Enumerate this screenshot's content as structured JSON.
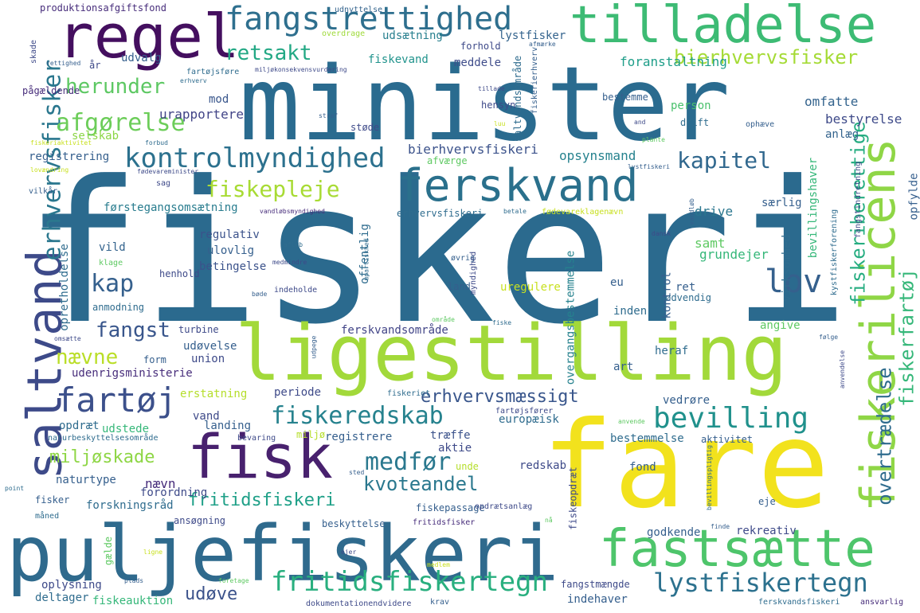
{
  "cloud": {
    "fiskeri": "fiskeri",
    "fare": "fare",
    "minister": "minister",
    "puljefiskeri": "puljefiskeri",
    "ligestilling": "ligestilling",
    "regel": "regel",
    "tilladelse": "tilladelse",
    "fangstrettighed": "fangstrettighed",
    "fisk": "fisk",
    "ferskvand": "ferskvand",
    "fastsaette": "fastsætte",
    "saltvand": "saltvand",
    "fiskerilicens": "fiskerilicens",
    "erhvervsfisker": "erhvervsfisker",
    "fartoej": "fartøj",
    "bevilling": "bevilling",
    "kontrolmyndighed": "kontrolmyndighed",
    "fritidsfiskertegn": "fritidsfiskertegn",
    "lystfiskertegn": "lystfiskertegn",
    "medfoer": "medfør",
    "fiskeredskab": "fiskeredskab",
    "afgoerelse": "afgørelse",
    "herunder": "herunder",
    "retsakt": "retsakt",
    "bierhvervsfisker": "bierhvervsfisker",
    "kapitel": "kapitel",
    "kap": "kap",
    "fiskepleje": "fiskepleje",
    "lov": "lov",
    "fangst": "fangst",
    "naevne": "nævne",
    "erhvervsmaessigt": "erhvervsmæssigt",
    "kvoteandel": "kvoteandel",
    "fritidsfiskeri": "fritidsfiskeri",
    "miljoeskade": "miljøskade",
    "udoeve": "udøve",
    "fiskeriberettige": "fiskeriberettige",
    "overtraedelse": "overtrædelse",
    "fiskerfartoej": "fiskerfartøj",
    "produktionsafgiftsfond": "produktionsafgiftsfond",
    "udnyttelse": "udnyttelse",
    "udsaetning": "udsætning",
    "lystfisker": "lystfisker",
    "overdrage": "overdrage",
    "fiskevand": "fiskevand",
    "udvalg": "udvalg",
    "meddele": "meddele",
    "foranstaltning": "foranstaltning",
    "omfatte": "omfatte",
    "mod": "mod",
    "person": "person",
    "bestyrelse": "bestyrelse",
    "anlaeg": "anlæg",
    "urapportere": "urapportere",
    "selskab": "selskab",
    "bierhvervsfiskeri": "bierhvervsfiskeri",
    "opsynsmand": "opsynsmand",
    "registrering": "registrering",
    "foerstegangsomsaetning": "førstegangsomsætning",
    "drive": "drive",
    "saerlig": "særlig",
    "regulativ": "regulativ",
    "ulovlig": "ulovlig",
    "betingelse": "betingelse",
    "offentlig": "offentlig",
    "samt": "samt",
    "grundejer": "grundejer",
    "vild": "vild",
    "henhold": "henhold",
    "land": "land",
    "uregulere": "uregulere",
    "ret": "ret",
    "noedvendig": "nødvendig",
    "kontrol": "kontrol",
    "inden": "inden",
    "eu": "eu",
    "ferskvandsomraade": "ferskvandsområde",
    "angive": "angive",
    "udoevelse": "udøvelse",
    "union": "union",
    "udenrigsministerie": "udenrigsministerie",
    "heraf": "heraf",
    "art": "art",
    "erstatning": "erstatning",
    "periode": "periode",
    "vedroere": "vedrøre",
    "opdraet": "opdræt",
    "udstede": "udstede",
    "vand": "vand",
    "landing": "landing",
    "europaeisk": "europæisk",
    "registrere": "registrere",
    "traeffe": "træffe",
    "aktie": "aktie",
    "bestemmelse": "bestemmelse",
    "aktivitet": "aktivitet",
    "naturbeskyttelsesomraade": "naturbeskyttelsesområde",
    "bevaring": "bevaring",
    "miljoe": "miljø",
    "naturtype": "naturtype",
    "naevn": "nævn",
    "redskab": "redskab",
    "fond": "fond",
    "unde": "unde",
    "forordning": "forordning",
    "fisker": "fisker",
    "forskningsraad": "forskningsråd",
    "fiskepassage": "fiskepassage",
    "opdraetsanlaeg": "opdrætsanlæg",
    "eje": "eje",
    "maaned": "måned",
    "ansoegning": "ansøgning",
    "beskyttelse": "beskyttelse",
    "fritidsfisker": "fritidsfisker",
    "godkende": "godkende",
    "rekreativ": "rekreativ",
    "oplysning": "oplysning",
    "deltager": "deltager",
    "fiskeauktion": "fiskeauktion",
    "dokumentationendvidere": "dokumentationendvidere",
    "krav": "krav",
    "fangstmaengde": "fangstmængde",
    "indehaver": "indehaver",
    "ferskvandsfiskeri": "ferskvandsfiskeri",
    "ansvarlig": "ansvarlig",
    "drift": "drift",
    "ophaeve": "ophæve",
    "hensyn": "hensyn",
    "bestemme": "bestemme",
    "saltvandsomraade": "saltvandsområde",
    "stoede": "støde",
    "afvaerge": "afværge",
    "erhvervsfiskeri": "erhvervsfiskeri",
    "fiskeopdraet": "fiskeopdræt",
    "overgangsbestemmelse": "overgangsbestemmelse",
    "virksomhed": "virksomhed",
    "bevillingshaver": "bevillingshaver",
    "kystfiskerforening": "kystfiskerforening",
    "opfylde": "opfylde",
    "fangstindretning": "fangstindretning",
    "pagaeldende": "pågældende",
    "opretholdelse": "opretholdelse",
    "anmodning": "anmodning",
    "turbine": "turbine",
    "form": "form",
    "aar": "år",
    "skade": "skade",
    "rettighed": "rettighed",
    "fartoejsfoere": "fartøjsføre",
    "miljoekonsekvensvurdering": "miljøkonsekvensvurdering",
    "forhold": "forhold",
    "afmaerke": "afmærke",
    "erhverv": "erhverv",
    "fiskerierhverv": "fiskerierhverv",
    "saltvandsomraade2": "saltvandsområde",
    "tillade": "tillade",
    "straf": "straf",
    "fiskeriaktivitet": "fiskeriaktivitet",
    "forbud": "forbud",
    "plante": "plante",
    "lovaendring": "lovændring",
    "foedevareminister": "fødevareminister",
    "vilkaar": "vilkår",
    "sag": "sag",
    "vandloebsmyndighed": "vandløbsmyndighed",
    "klage": "klage",
    "medmindre": "medmindre",
    "boede": "bøde",
    "aflob": "afløb",
    "indeholde": "indeholde",
    "oevrig": "øvrig",
    "myndighed": "myndighed",
    "upartiskhed": "upartiskhed",
    "betale": "betale",
    "foedevareklagenaevn": "fødevareklagenævn",
    "dansk": "dansk",
    "lystfiskeri": "lystfiskeri",
    "vandloeb": "vandløb",
    "omraade": "område",
    "fiske": "fiske",
    "foelge": "følge",
    "anvendelse": "anvendelse",
    "omsaette": "omsætte",
    "udpege": "udpege",
    "fiskeriet": "fiskeriet",
    "fartoejsfoerer": "fartøjsfører",
    "anvende": "anvende",
    "sted": "sted",
    "point": "point",
    "gaelde": "gælde",
    "ligne": "ligne",
    "plads": "plads",
    "foretage": "foretage",
    "ejer": "ejer",
    "medlem": "medlem",
    "finde": "finde",
    "naa": "nå",
    "bevillingspligtig": "bevillingspligtig",
    "and": "and",
    "luu": "luu"
  }
}
